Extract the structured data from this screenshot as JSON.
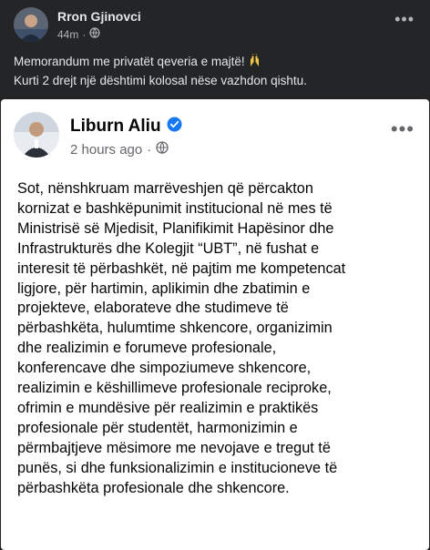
{
  "outer_post": {
    "author": "Rron Gjinovci",
    "time": "44m",
    "privacy_icon": "globe-icon",
    "lines": [
      "Memorandum me privatët qeveria e majtë!",
      "Kurti 2 drejt një dështimi kolosal nëse vazhdon qishtu."
    ],
    "emoji": "raised-hands-emoji"
  },
  "shared_post": {
    "author": "Liburn Aliu",
    "verified_icon": "verified-badge-icon",
    "time": "2 hours ago",
    "privacy_icon": "globe-icon",
    "body_lines": [
      "Sot, nënshkruam marrëveshjen që përcakton",
      "kornizat e bashkëpunimit institucional në mes të",
      "Ministrisë së Mjedisit, Planifikimit Hapësinor dhe",
      "Infrastrukturës dhe Kolegjit “UBT”, në fushat e",
      "interesit të përbashkët, në pajtim me kompetencat",
      "ligjore, për hartimin, aplikimin dhe zbatimin e",
      "projekteve, elaborateve dhe studimeve të",
      "përbashkëta, hulumtime shkencore, organizimin",
      "dhe realizimin e forumeve profesionale,",
      "konferencave dhe simpoziumeve shkencore,",
      "realizimin e këshillimeve profesionale reciproke,",
      "ofrimin e mundësive për realizimin e praktikës",
      "profesionale për studentët, harmonizimin e",
      "përmbajtjeve mësimore me nevojave e tregut të",
      "punës, si dhe funksionalizimin e institucioneve të",
      "përbashkëta profesionale dhe shkencore."
    ]
  },
  "colors": {
    "dark_bg": "#242526",
    "card_bg": "#ffffff",
    "verified_blue": "#1877f2"
  }
}
